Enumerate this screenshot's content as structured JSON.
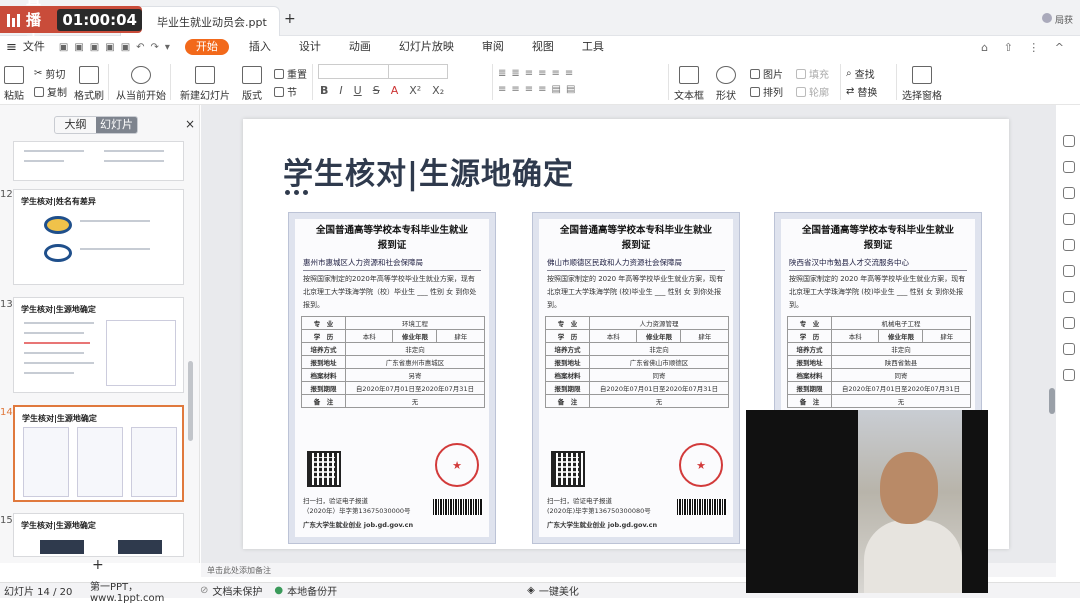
{
  "live": {
    "label": "直播中",
    "timer": "01:00:04"
  },
  "titlebar": {
    "doc_tab": "毕业生就业动员会.ppt",
    "new_tab": "+",
    "user": "局获"
  },
  "menubar": {
    "file": "文件",
    "items": [
      "开始",
      "插入",
      "设计",
      "动画",
      "幻灯片放映",
      "审阅",
      "视图",
      "工具"
    ]
  },
  "ribbon": {
    "paste": "粘贴",
    "cut": "剪切",
    "copy": "复制",
    "format_painter": "格式刷",
    "from_current": "从当前开始",
    "new_slide": "新建幻灯片",
    "layout": "版式",
    "reset": "重置",
    "section": "节",
    "textbox": "文本框",
    "shape": "形状",
    "arrange": "排列",
    "picture": "图片",
    "fill": "填充",
    "outline": "轮廓",
    "find": "查找",
    "replace": "替换",
    "select_pane": "选择窗格",
    "font_buttons": [
      "B",
      "I",
      "U",
      "S",
      "A",
      "X²",
      "X₂"
    ]
  },
  "sidebar": {
    "tab_outline": "大纲",
    "tab_slides": "幻灯片",
    "close": "×",
    "add": "+",
    "thumbs": [
      {
        "num": "12",
        "title": "学生核对|姓名有差异"
      },
      {
        "num": "13",
        "title": "学生核对|生源地确定"
      },
      {
        "num": "14",
        "title": "学生核对|生源地确定"
      },
      {
        "num": "15",
        "title": "学生核对|生源地确定"
      }
    ]
  },
  "slide": {
    "title": "学生核对|生源地确定",
    "certs": [
      {
        "title": "全国普通高等学校本专科毕业生就业\n报到证",
        "agency": "惠州市惠城区人力资源和社会保障局",
        "body": "按照国家制定的2020年高等学校毕业生就业方案，现有北京理工大学珠海学院（校）毕业生 ___ 性别 女 到你处报到。",
        "rows": [
          [
            "专　业",
            "环境工程"
          ],
          [
            "学　历",
            "本科",
            "修业年限",
            "肆年"
          ],
          [
            "培养方式",
            "非定向"
          ],
          [
            "报到地址",
            "广东省惠州市惠城区"
          ],
          [
            "档案材料",
            "另寄"
          ],
          [
            "报到期限",
            "自2020年07月01日至2020年07月31日"
          ],
          [
            "备　注",
            "无"
          ]
        ],
        "seal": "★",
        "foot1": "扫一扫，验证电子报道",
        "foot2": "（2020年）毕字第13675030000号",
        "foot3": "广东大学生就业创业 job.gd.gov.cn"
      },
      {
        "title": "全国普通高等学校本专科毕业生就业\n报到证",
        "agency": "佛山市顺德区民政和人力资源社会保障局",
        "body": "按照国家制定的 2020 年高等学校毕业生就业方案，现有 北京理工大学珠海学院 (校)毕业生 ___ 性别 女 到你处报到。",
        "rows": [
          [
            "专　业",
            "人力资源管理"
          ],
          [
            "学　历",
            "本科",
            "修业年限",
            "肆年"
          ],
          [
            "培养方式",
            "非定向"
          ],
          [
            "报到地址",
            "广东省佛山市顺德区"
          ],
          [
            "档案材料",
            "同寄"
          ],
          [
            "报到期限",
            "自2020年07月01日至2020年07月31日"
          ],
          [
            "备　注",
            "无"
          ]
        ],
        "seal": "★",
        "foot1": "扫一扫，验证电子报道",
        "foot2": "(2020年)毕字第136750300080号",
        "foot3": "广东大学生就业创业 job.gd.gov.cn"
      },
      {
        "title": "全国普通高等学校本专科毕业生就业\n报到证",
        "agency": "陕西省汉中市勉县人才交流服务中心",
        "body": "按照国家制定的 2020 年高等学校毕业生就业方案，现有 北京理工大学珠海学院 (校)毕业生 ___ 性别 女 到你处报到。",
        "rows": [
          [
            "专　业",
            "机械电子工程"
          ],
          [
            "学　历",
            "本科",
            "修业年限",
            "肆年"
          ],
          [
            "培养方式",
            "非定向"
          ],
          [
            "报到地址",
            "陕西省勉县"
          ],
          [
            "档案材料",
            "同寄"
          ],
          [
            "报到期限",
            "自2020年07月01日至2020年07月31日"
          ],
          [
            "备　注",
            "无"
          ]
        ],
        "seal": "★",
        "foot1": "",
        "foot2": "",
        "foot3": ""
      }
    ]
  },
  "notes": "单击此处添加备注",
  "status": {
    "slide_count": "幻灯片 14 / 20",
    "theme": "第一PPT，www.1ppt.com",
    "doc_protect": "文档未保护",
    "backup": "本地备份开",
    "beautify": "一键美化"
  },
  "colors": {
    "accent": "#f2691b",
    "live": "#c94c3a",
    "title": "#2f3a4d"
  }
}
